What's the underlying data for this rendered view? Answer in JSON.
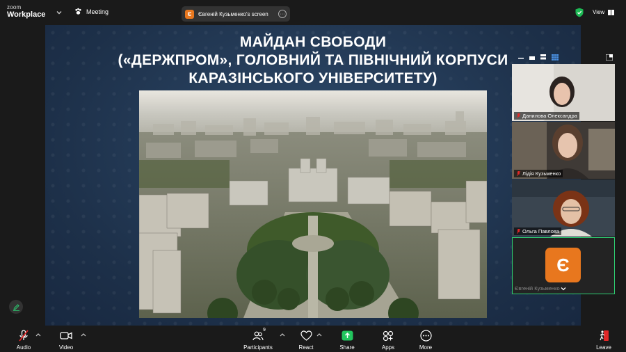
{
  "app": {
    "logo_line1": "zoom",
    "logo_line2": "Workplace"
  },
  "header": {
    "meeting_label": "Meeting",
    "share_avatar_initial": "Є",
    "share_title": "Євгеній Кузьменко's screen",
    "view_label": "View"
  },
  "slide": {
    "title_line1": "МАЙДАН СВОБОДИ",
    "title_line2": "(«ДЕРЖПРОМ», ГОЛОВНИЙ ТА ПІВНІЧНИЙ КОРПУСИ",
    "title_line3": "КАРАЗІНСЬКОГО УНІВЕРСИТЕТУ)"
  },
  "participants_panel": [
    {
      "name": "Данилова Олександра",
      "muted": true
    },
    {
      "name": "Лідія Кузьменко",
      "muted": true
    },
    {
      "name": "Ольга Павлова",
      "muted": true
    },
    {
      "name": "Євгеній Кузьменко",
      "initial": "Є",
      "active_speaker": true
    }
  ],
  "toolbar": {
    "audio": "Audio",
    "video": "Video",
    "participants": "Participants",
    "participants_count": "9",
    "react": "React",
    "share": "Share",
    "apps": "Apps",
    "more": "More",
    "leave": "Leave"
  },
  "colors": {
    "accent_green": "#1db954",
    "share_green": "#22c55e",
    "avatar_orange": "#e8771e",
    "leave_red": "#e02828",
    "slide_bg": "#243a55"
  },
  "icons": [
    "chevron-down-icon",
    "paw-icon",
    "more-icon",
    "shield-check-icon",
    "grid-view-icon",
    "microphone-muted-icon",
    "camera-icon",
    "people-icon",
    "heart-icon",
    "share-arrow-icon",
    "apps-icon",
    "ellipsis-icon",
    "door-exit-icon",
    "pencil-icon"
  ]
}
